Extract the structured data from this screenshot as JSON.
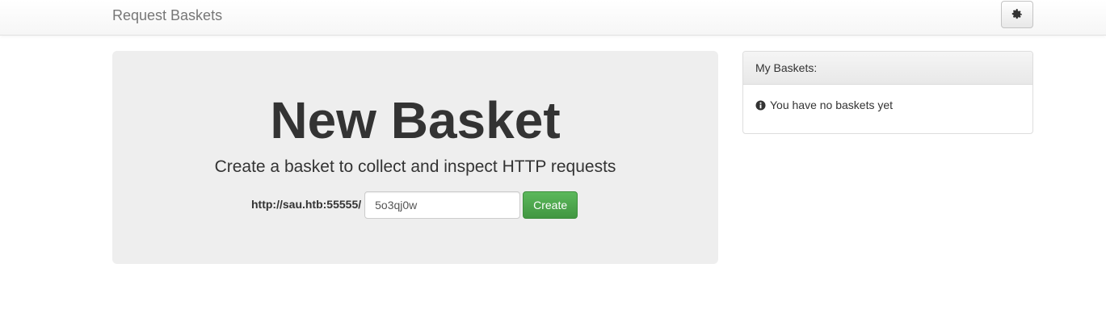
{
  "navbar": {
    "brand": "Request Baskets",
    "settings_icon": "gear-icon"
  },
  "jumbotron": {
    "title": "New Basket",
    "subtitle": "Create a basket to collect and inspect HTTP requests",
    "url_prefix": "http://sau.htb:55555/",
    "basket_name_value": "5o3qj0w",
    "create_label": "Create"
  },
  "baskets_panel": {
    "heading": "My Baskets:",
    "info_icon": "info-circle-icon",
    "empty_message": "You have no baskets yet"
  },
  "colors": {
    "create_button": "#5cb85c",
    "jumbotron_bg": "#eeeeee",
    "brand_text": "#777777"
  }
}
